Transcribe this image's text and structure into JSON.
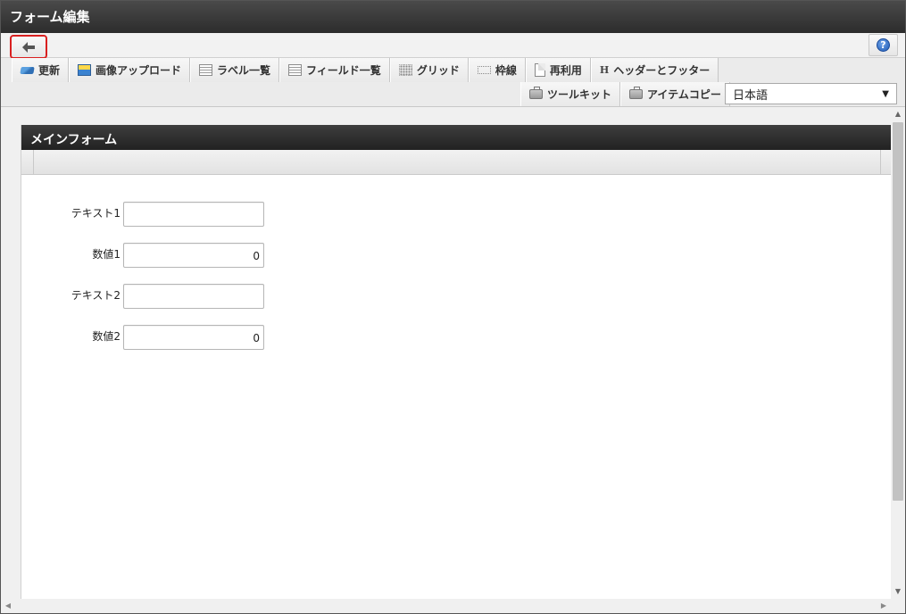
{
  "window": {
    "title": "フォーム編集"
  },
  "nav": {
    "back_icon": "arrow-left-icon",
    "help_icon": "help-icon",
    "help_glyph": "?"
  },
  "toolbar": {
    "row1": [
      {
        "label": "更新",
        "icon": "refresh-icon"
      },
      {
        "label": "画像アップロード",
        "icon": "image-upload-icon"
      },
      {
        "label": "ラベル一覧",
        "icon": "label-list-icon"
      },
      {
        "label": "フィールド一覧",
        "icon": "field-list-icon"
      },
      {
        "label": "グリッド",
        "icon": "grid-icon"
      },
      {
        "label": "枠線",
        "icon": "border-icon"
      },
      {
        "label": "再利用",
        "icon": "reuse-icon"
      },
      {
        "label": "ヘッダーとフッター",
        "icon": "header-footer-icon",
        "glyph": "H"
      }
    ],
    "row2": [
      {
        "label": "ツールキット",
        "icon": "toolkit-icon"
      },
      {
        "label": "アイテムコピー",
        "icon": "item-copy-icon"
      }
    ],
    "language": {
      "selected": "日本語",
      "arrow": "▼"
    }
  },
  "panel": {
    "title": "メインフォーム",
    "fields": [
      {
        "label": "テキスト1",
        "value": ""
      },
      {
        "label": "数値1",
        "value": "0"
      },
      {
        "label": "テキスト2",
        "value": ""
      },
      {
        "label": "数値2",
        "value": "0"
      }
    ]
  },
  "scroll": {
    "up": "▲",
    "down": "▼",
    "left": "◀",
    "right": "▶"
  }
}
